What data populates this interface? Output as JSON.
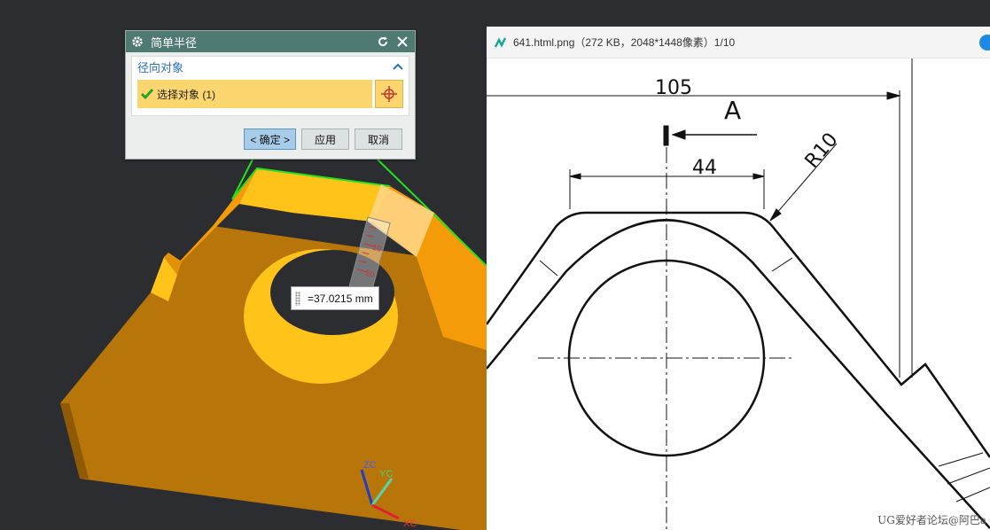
{
  "dialog": {
    "title": "简单半径",
    "group_label": "径向对象",
    "select_label": "选择对象 (1)",
    "buttons": {
      "ok": "< 确定 >",
      "apply": "应用",
      "cancel": "取消"
    }
  },
  "measurement": {
    "value": "=37.0215 mm"
  },
  "ruler": {
    "labels": [
      "10",
      "20"
    ]
  },
  "triad": {
    "zc": "ZC",
    "yc": "YC",
    "xc": "XC"
  },
  "viewer": {
    "file_info": "641.html.png（272 KB，2048*1448像素）1/10",
    "watermark": "UG爱好者论坛@阿巴a"
  },
  "drawing": {
    "dim_overall": "105",
    "section_label": "A",
    "dim_width": "44",
    "dim_radius": "R10"
  },
  "colors": {
    "viewport_bg": "#2b2d30",
    "part_orange": "#f59b0a",
    "part_dark": "#b8760a",
    "edge_green": "#22e022",
    "title_bar": "#4f7a72",
    "selection": "#fbd66e"
  }
}
